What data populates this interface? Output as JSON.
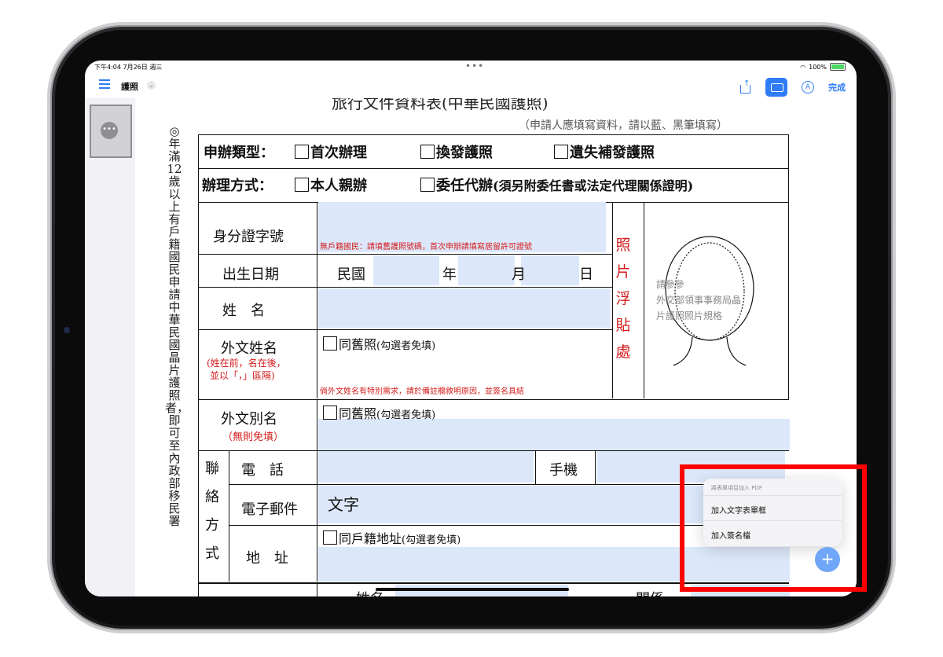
{
  "status_bar": {
    "time": "下午4:04  7月26日 週三",
    "dots": "•••",
    "battery": "100%"
  },
  "toolbar": {
    "title": "護照",
    "done_label": "完成"
  },
  "sidebar": {
    "thumb_more": "•••"
  },
  "document": {
    "cut_title": "旅行文件資料表(中華民國護照)",
    "note": "（申請人應填寫資料，請以藍、黑筆填寫）",
    "vertical_text": "◎年滿12歲以上有戶籍國民申請中華民國晶片護照者，即可至內政部移民署",
    "apply_type": {
      "label": "申辦類型：",
      "opt1": "首次辦理",
      "opt2": "換發護照",
      "opt3": "遺失補發護照"
    },
    "method": {
      "label": "辦理方式：",
      "opt1": "本人親辦",
      "opt2": "委任代辦",
      "opt2_note": "(須另附委任書或法定代理關係證明)"
    },
    "id_label": "身分證字號",
    "id_note": "無戶籍國民：請填舊護照號碼，首次申辦請填寫居留許可證號",
    "birth_label": "出生日期",
    "birth_min": "民國",
    "birth_year": "年",
    "birth_month": "月",
    "birth_day": "日",
    "name_label": "姓　名",
    "foreign_name_label": "外文姓名",
    "foreign_name_note1": "(姓在前，名在後，",
    "foreign_name_note2": "並以「，」區隔)",
    "same_passport": "同舊照",
    "same_passport_note": "(勾選者免填)",
    "foreign_name_red": "倘外文姓名有特別需求，請於備註欄敘明原因，並簽名具結",
    "alias_label": "外文別名",
    "alias_note": "（無則免填）",
    "photo_chars": [
      "照",
      "片",
      "浮",
      "貼",
      "處"
    ],
    "photo_ref1": "請參參",
    "photo_ref2": "外交部領事事務局晶",
    "photo_ref3": "片護照照片規格",
    "contact_chars": [
      "聯",
      "絡",
      "方",
      "式"
    ],
    "phone_label": "電　話",
    "mobile_label": "手機",
    "email_label": "電子郵件",
    "email_value": "文字",
    "address_label": "地　址",
    "same_address": "同戶籍地址",
    "same_address_note": "(勾選者免填)",
    "bottom_partial1": "姓名",
    "bottom_partial2": "關係"
  },
  "popover": {
    "header": "將表單項目加入 PDF",
    "item1": "加入文字表單框",
    "item2": "加入簽名檔"
  },
  "fab": {
    "plus": "+"
  },
  "colors": {
    "accent": "#2f7cf6",
    "field_fill": "#dce8fa",
    "red_text": "#d41b1b",
    "highlight": "#ff0000"
  }
}
